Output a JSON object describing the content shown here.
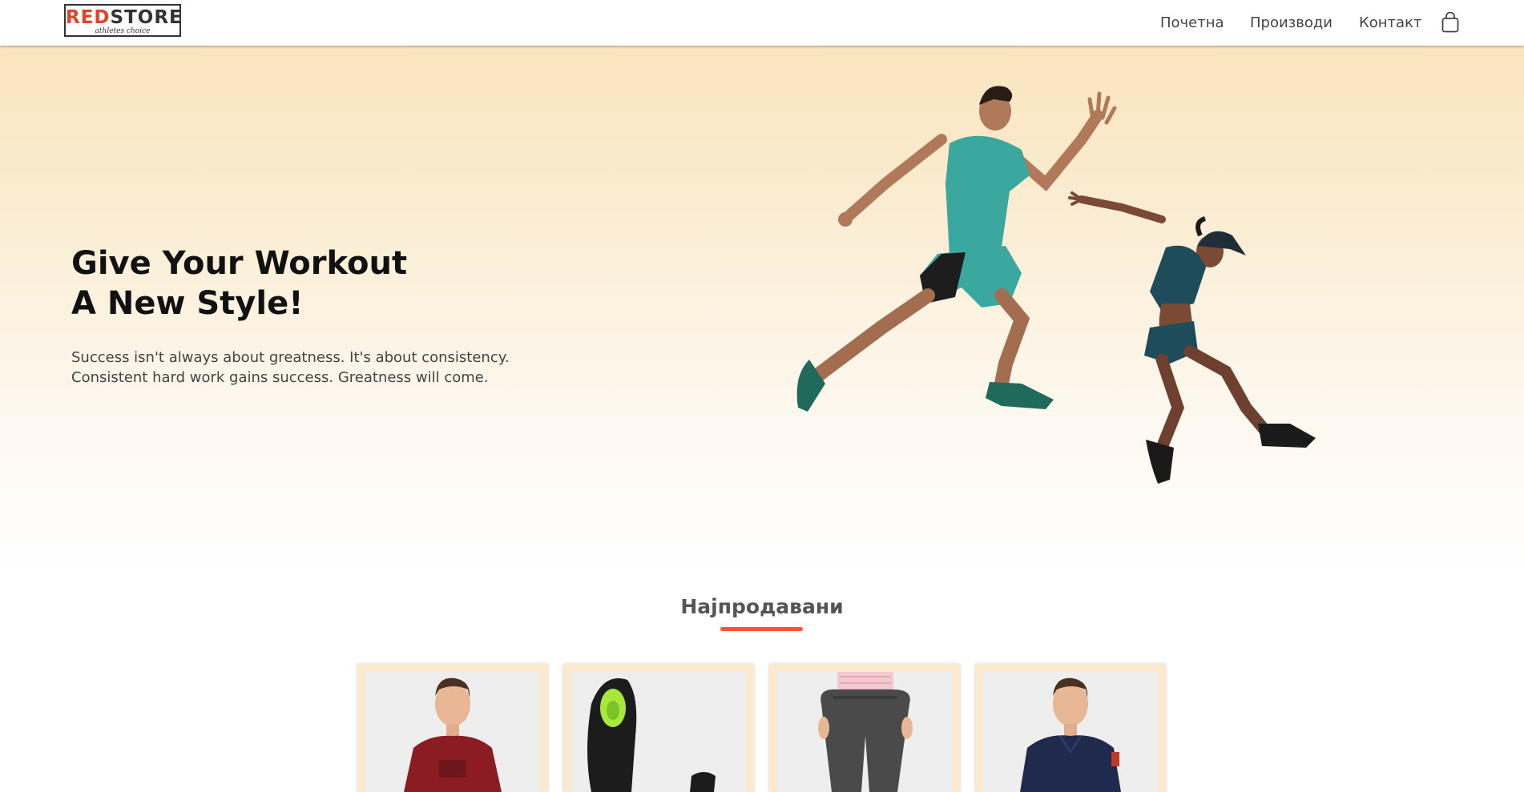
{
  "navbar": {
    "logo": {
      "brand_part_red": "RED",
      "brand_part_dark": "STORE",
      "tagline": "athletes choice"
    },
    "links": [
      {
        "label": "Почетна"
      },
      {
        "label": "Производи"
      },
      {
        "label": "Контакт"
      }
    ],
    "cart_icon": "shopping-bag-icon"
  },
  "hero": {
    "title_line1": "Give Your Workout",
    "title_line2": "A New Style!",
    "tagline_line1": "Success isn't always about greatness. It's about consistency.",
    "tagline_line2": "Consistent hard work gains success. Greatness will come."
  },
  "featured": {
    "title": "Најпродавани",
    "accent_color": "#ff523b"
  },
  "colors": {
    "accent": "#ff523b",
    "hero_gradient_top": "#f9e4bd"
  }
}
